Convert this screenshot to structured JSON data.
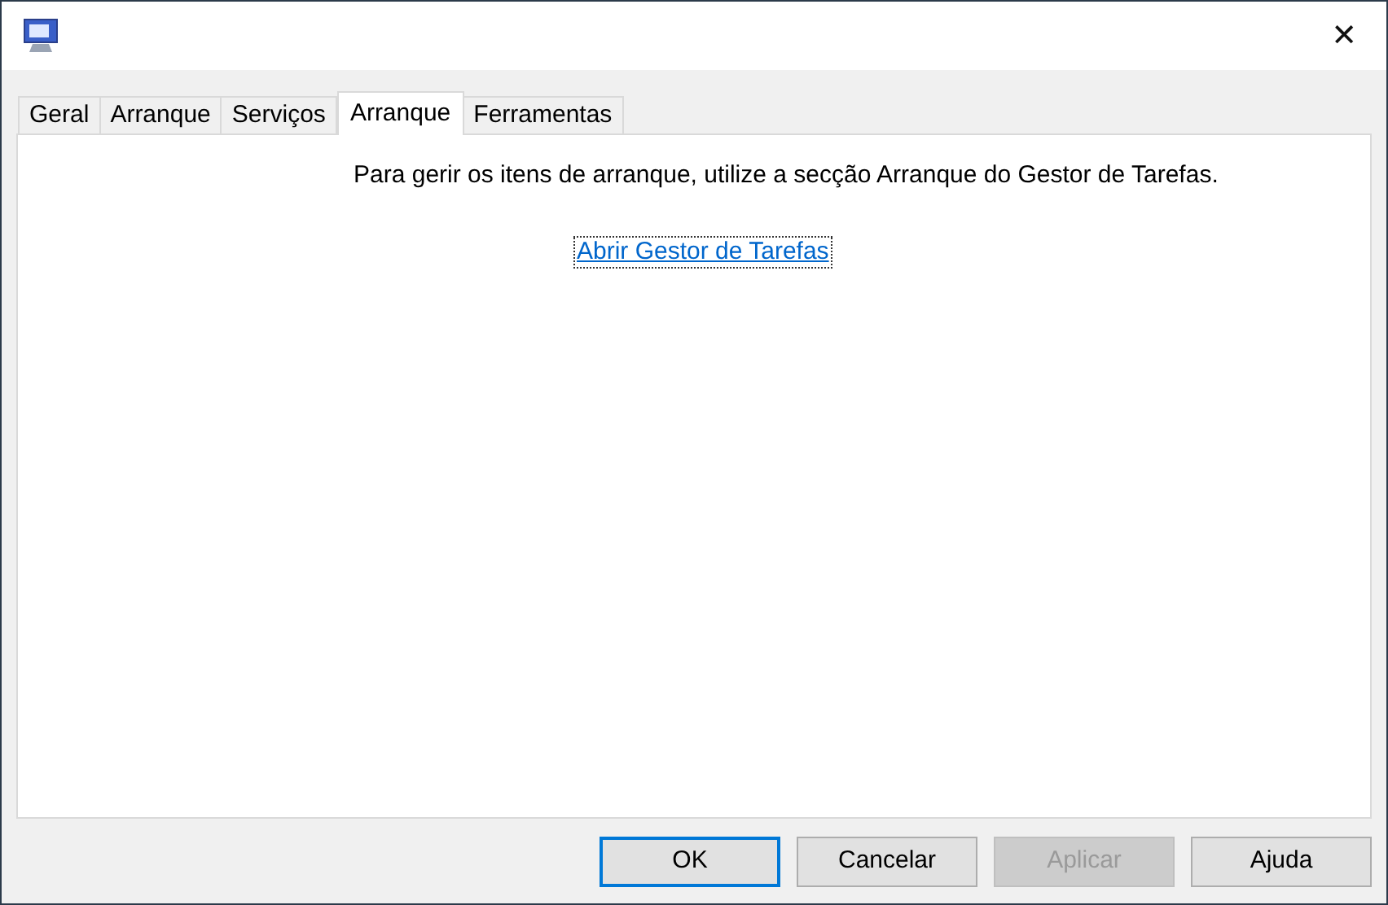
{
  "window": {
    "close": "✕"
  },
  "tabs": [
    {
      "label": "Geral",
      "selected": false
    },
    {
      "label": "Arranque",
      "selected": false
    },
    {
      "label": "Serviços",
      "selected": false
    },
    {
      "label": "Arranque",
      "selected": true
    },
    {
      "label": "Ferramentas",
      "selected": false
    }
  ],
  "panel": {
    "message": "Para gerir os itens de arranque, utilize a secção Arranque do Gestor de Tarefas.",
    "link": "Abrir Gestor de Tarefas"
  },
  "buttons": [
    {
      "label": "OK",
      "default": true,
      "disabled": false
    },
    {
      "label": "Cancelar",
      "default": false,
      "disabled": false
    },
    {
      "label": "Aplicar",
      "default": false,
      "disabled": true
    },
    {
      "label": "Ajuda",
      "default": false,
      "disabled": false
    }
  ]
}
